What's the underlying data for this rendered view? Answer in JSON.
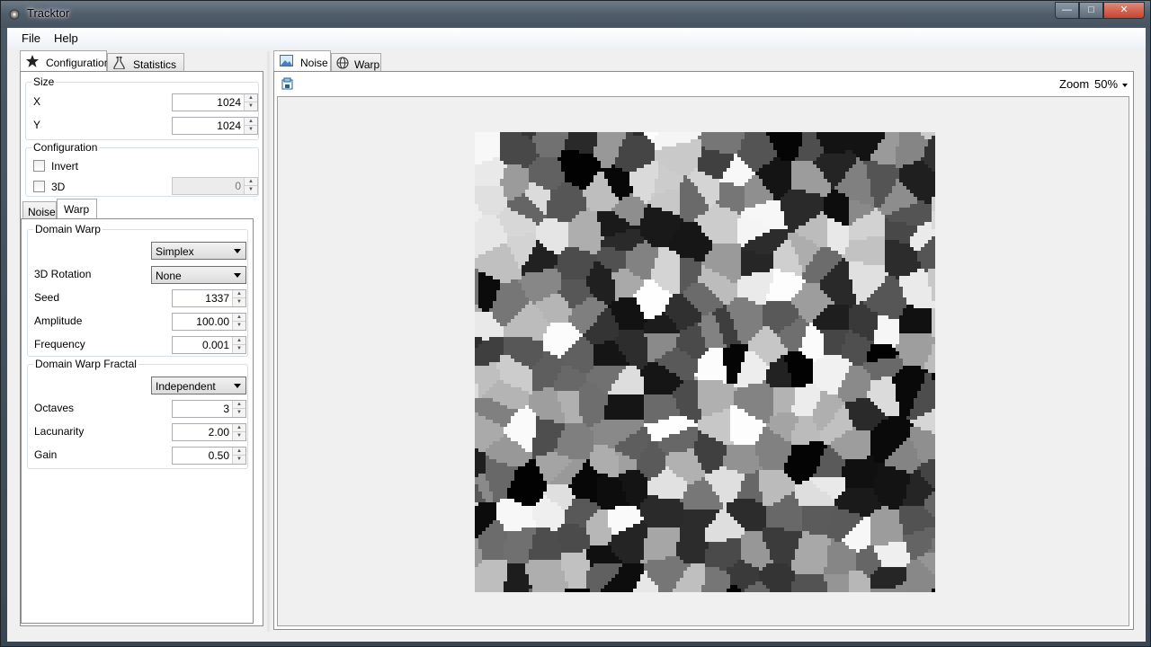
{
  "window": {
    "title": "Tracktor",
    "minimize": "—",
    "maximize": "□",
    "close": "✕"
  },
  "menu": {
    "file": "File",
    "help": "Help"
  },
  "left_tabs": {
    "configuration": "Configuration",
    "statistics": "Statistics"
  },
  "size": {
    "title": "Size",
    "x_label": "X",
    "x_value": "1024",
    "y_label": "Y",
    "y_value": "1024"
  },
  "configuration": {
    "title": "Configuration",
    "invert_label": "Invert",
    "invert_checked": false,
    "threed_label": "3D",
    "threed_checked": false,
    "threed_value": "0"
  },
  "sub_tabs": {
    "noise": "Noise",
    "warp": "Warp"
  },
  "domain_warp": {
    "title": "Domain Warp",
    "type_value": "Simplex",
    "rotation_label": "3D Rotation",
    "rotation_value": "None",
    "seed_label": "Seed",
    "seed_value": "1337",
    "amplitude_label": "Amplitude",
    "amplitude_value": "100.00",
    "frequency_label": "Frequency",
    "frequency_value": "0.001"
  },
  "domain_warp_fractal": {
    "title": "Domain Warp Fractal",
    "type_value": "Independent",
    "octaves_label": "Octaves",
    "octaves_value": "3",
    "lacunarity_label": "Lacunarity",
    "lacunarity_value": "2.00",
    "gain_label": "Gain",
    "gain_value": "0.50"
  },
  "right_tabs": {
    "noise": "Noise",
    "warp": "Warp"
  },
  "preview": {
    "zoom_label": "Zoom",
    "zoom_value": "50%"
  },
  "icons": {
    "app": "gear-icon",
    "configuration_tab": "star-icon",
    "statistics_tab": "flask-icon",
    "noise_tab": "image-icon",
    "warp_tab": "globe-icon",
    "save": "save-image-icon",
    "zoom_dropdown": "chevron-down-icon"
  }
}
